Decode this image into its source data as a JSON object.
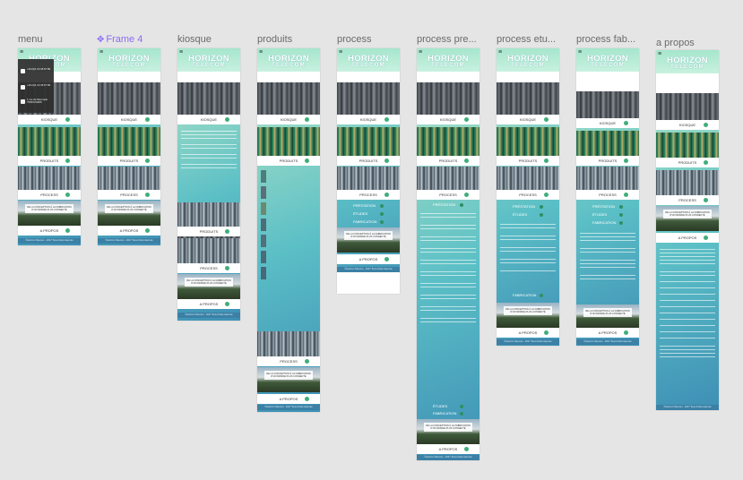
{
  "frames": [
    {
      "label": "menu",
      "selected": false
    },
    {
      "label": "Frame 4",
      "selected": true,
      "icon": "frame-icon"
    },
    {
      "label": "kiosque",
      "selected": false
    },
    {
      "label": "produits",
      "selected": false
    },
    {
      "label": "process",
      "selected": false
    },
    {
      "label": "process pre...",
      "selected": false
    },
    {
      "label": "process etu...",
      "selected": false
    },
    {
      "label": "process fab...",
      "selected": false
    },
    {
      "label": "a propos",
      "selected": false
    }
  ],
  "site": {
    "logo_top": "HORIZON",
    "logo_bottom": "TELECOM",
    "menu_icon": "hamburger-icon",
    "buttons": {
      "kiosque": "KIOSQUE",
      "produits": "PRODUITS",
      "process": "PROCESS",
      "a_propos": "A PROPOS"
    },
    "caption": "DE LA CONCEPTION À LA FABRICATION D'UN MONDE PLUS CONNECTÉ",
    "footer": "©Horizon Telecom - 2017 Tous droits réservés",
    "process_steps": [
      "PRÉSTATION",
      "ÉTUDES",
      "FABRICATION"
    ],
    "menu_items": [
      "+33 (0)1 23 45 67 89",
      "+33 (0)1 23 45 67 89",
      "1 rue de l'Exemple 75000 PARIS"
    ]
  },
  "colors": {
    "canvas_bg": "#e5e5e5",
    "selected_label": "#8a6cf2",
    "gradient_top": "#b9e9cf",
    "gradient_bottom": "#3e8fb5",
    "accent_dot": "#3fae7a"
  }
}
